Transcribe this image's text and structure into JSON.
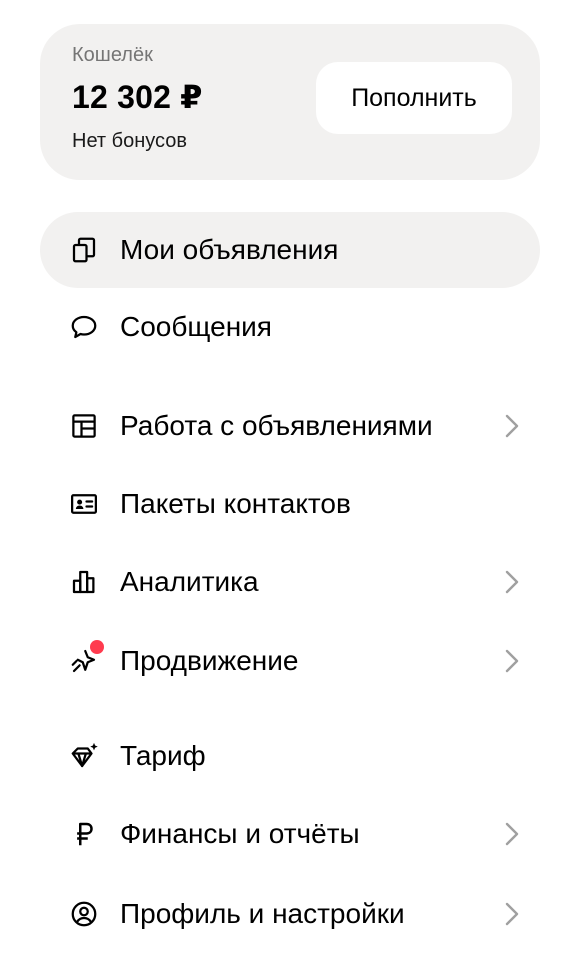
{
  "wallet": {
    "label": "Кошелёк",
    "balance": "12 302 ₽",
    "bonus": "Нет бонусов",
    "topup_label": "Пополнить"
  },
  "menu": {
    "items": [
      {
        "label": "Мои объявления",
        "icon": "listings-icon",
        "active": true,
        "chevron": false
      },
      {
        "label": "Сообщения",
        "icon": "chat-bubble-icon",
        "active": false,
        "chevron": false
      },
      {
        "label": "Работа с объявлениями",
        "icon": "layout-icon",
        "active": false,
        "chevron": true
      },
      {
        "label": "Пакеты контактов",
        "icon": "contact-card-icon",
        "active": false,
        "chevron": false
      },
      {
        "label": "Аналитика",
        "icon": "bar-chart-icon",
        "active": false,
        "chevron": true
      },
      {
        "label": "Продвижение",
        "icon": "promotion-icon",
        "active": false,
        "chevron": true,
        "badge": true
      },
      {
        "label": "Тариф",
        "icon": "diamond-sparkle-icon",
        "active": false,
        "chevron": false
      },
      {
        "label": "Финансы и отчёты",
        "icon": "ruble-icon",
        "active": false,
        "chevron": true
      },
      {
        "label": "Профиль и настройки",
        "icon": "profile-icon",
        "active": false,
        "chevron": true
      }
    ]
  },
  "colors": {
    "card_bg": "#f2f1f0",
    "badge": "#ff3b4e",
    "chevron": "#a0a0a0",
    "muted_text": "#757575"
  }
}
